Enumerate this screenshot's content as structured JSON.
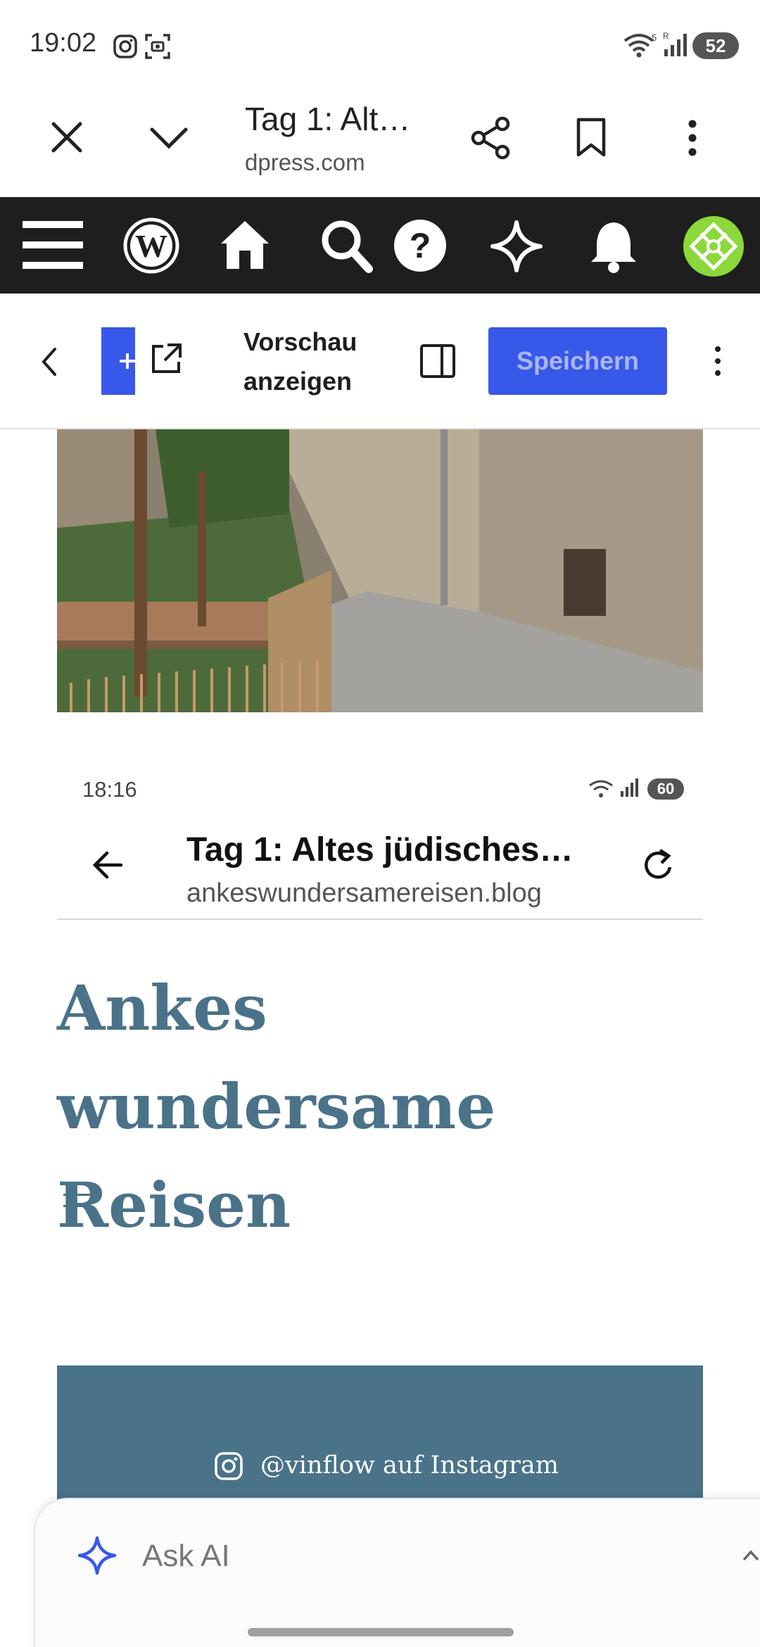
{
  "status_bar": {
    "time": "19:02",
    "battery": "52",
    "icons": [
      "instagram-icon",
      "screen-record-icon",
      "wifi-icon",
      "signal-icon"
    ]
  },
  "browser": {
    "tab_title": "Tag 1: Alt…",
    "domain": "dpress.com",
    "icons": [
      "close-icon",
      "chevron-down-icon",
      "share-icon",
      "bookmark-icon",
      "more-icon"
    ]
  },
  "wp_admin_bar": {
    "icons": [
      "menu-icon",
      "wordpress-icon",
      "home-icon",
      "search-icon",
      "help-icon",
      "sparkle-icon",
      "bell-icon",
      "avatar"
    ]
  },
  "editor_toolbar": {
    "preview_label": "Vorschau anzeigen",
    "save_label": "Speichern"
  },
  "inner_screenshot": {
    "time": "18:16",
    "battery": "60",
    "page_title": "Tag 1: Altes jüdisches…",
    "domain": "ankeswundersamereisen.blog",
    "site_title": "Ankes wundersame Reisen",
    "instagram_label": "@vinflow auf Instagram"
  },
  "ask_ai": {
    "label": "Ask AI"
  },
  "colors": {
    "admin_bar": "#1e1e1e",
    "accent": "#3858e9",
    "site_blue": "#4a7289"
  }
}
